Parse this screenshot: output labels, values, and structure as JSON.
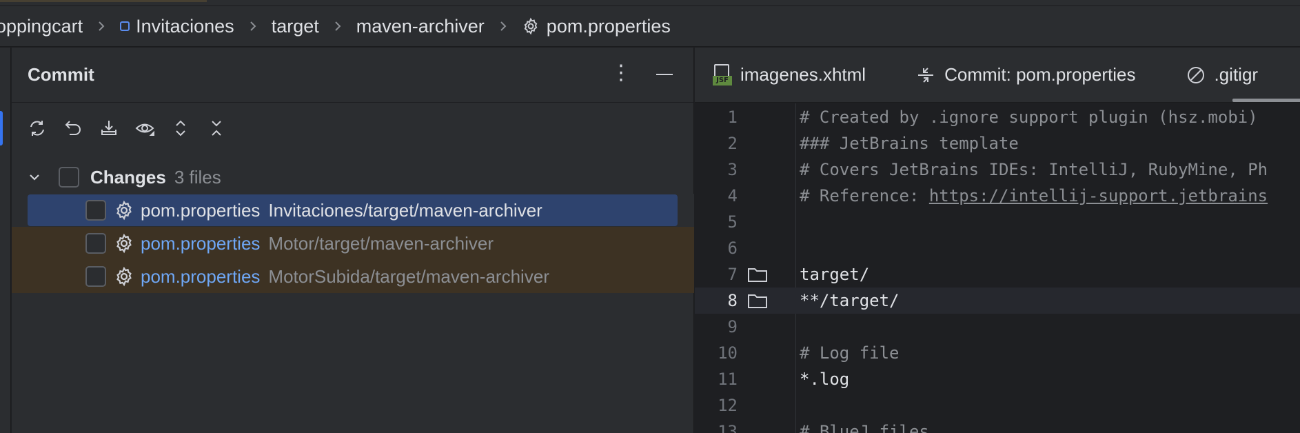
{
  "breadcrumb": {
    "items": [
      "oppingcart",
      "Invitaciones",
      "target",
      "maven-archiver",
      "pom.properties"
    ]
  },
  "commit": {
    "title": "Commit",
    "toolbar": {
      "icons": [
        "refresh-icon",
        "rollback-icon",
        "shelve-icon",
        "preview-icon",
        "expand-all-icon",
        "collapse-all-icon"
      ]
    },
    "group": {
      "label": "Changes",
      "count": "3 files"
    },
    "files": [
      {
        "name": "pom.properties",
        "path": "Invitaciones/target/maven-archiver",
        "selected": true
      },
      {
        "name": "pom.properties",
        "path": "Motor/target/maven-archiver",
        "selected": false
      },
      {
        "name": "pom.properties",
        "path": "MotorSubida/target/maven-archiver",
        "selected": false
      }
    ]
  },
  "editor": {
    "tabs": [
      {
        "label": "imagenes.xhtml",
        "icon": "jsf-file-icon"
      },
      {
        "label": "Commit: pom.properties",
        "icon": "commit-icon"
      },
      {
        "label": ".gitignore",
        "visible_text": ".gitigr",
        "icon": "ignore-file-icon"
      }
    ],
    "lines": [
      {
        "n": "1",
        "text": "# Created by .ignore support plugin (hsz.mobi)"
      },
      {
        "n": "2",
        "text": "### JetBrains template"
      },
      {
        "n": "3",
        "text": "# Covers JetBrains IDEs: IntelliJ, RubyMine, Ph"
      },
      {
        "n": "4",
        "prefix": "# Reference: ",
        "link": "https://intellij-support.jetbrains"
      },
      {
        "n": "5",
        "text": ""
      },
      {
        "n": "6",
        "text": ""
      },
      {
        "n": "7",
        "text": "target/"
      },
      {
        "n": "8",
        "text": "**/target/"
      },
      {
        "n": "9",
        "text": ""
      },
      {
        "n": "10",
        "text": "# Log file"
      },
      {
        "n": "11",
        "text": "*.log"
      },
      {
        "n": "12",
        "text": ""
      },
      {
        "n": "13",
        "text": "# BlueJ files"
      }
    ]
  },
  "colors": {
    "accent": "#3574f0",
    "selection": "#2e436e",
    "modified_row": "#3d3223",
    "file_link": "#6fa7f5"
  }
}
